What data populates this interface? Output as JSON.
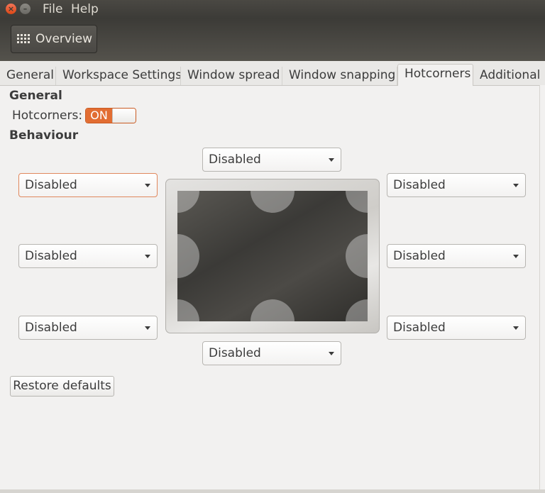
{
  "menubar": {
    "close_symbol": "×",
    "minimize_symbol": "–",
    "items": [
      "File",
      "Help"
    ]
  },
  "toolbar": {
    "overview_label": "Overview",
    "overview_icon": "grid-icon"
  },
  "tabs": [
    {
      "label": "General"
    },
    {
      "label": "Workspace Settings"
    },
    {
      "label": "Window spread"
    },
    {
      "label": "Window snapping"
    },
    {
      "label": "Hotcorners",
      "active": true
    },
    {
      "label": "Additional"
    }
  ],
  "general": {
    "heading": "General",
    "hotcorners_label": "Hotcorners:",
    "hotcorners_state": "ON"
  },
  "behaviour": {
    "heading": "Behaviour",
    "top": "Disabled",
    "top_left": "Disabled",
    "top_right": "Disabled",
    "left": "Disabled",
    "right": "Disabled",
    "bottom_left": "Disabled",
    "bottom_right": "Disabled",
    "bottom": "Disabled"
  },
  "restore_label": "Restore defaults",
  "colors": {
    "accent": "#e26d32",
    "menubar": "#3c3b37",
    "window_bg": "#f2f1f0"
  }
}
